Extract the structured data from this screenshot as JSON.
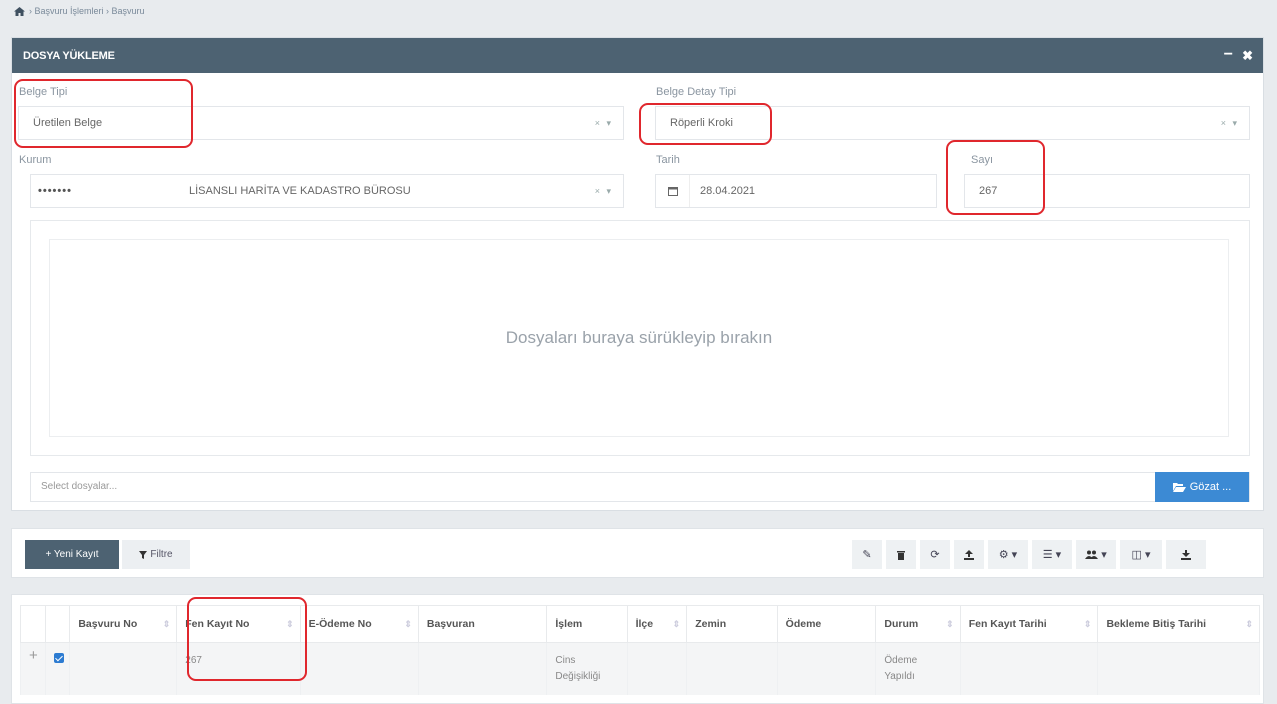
{
  "breadcrumb": {
    "icon": "home-icon",
    "text": "› Başvuru İşlemleri › Başvuru"
  },
  "panel": {
    "title": "DOSYA YÜKLEME",
    "minimize": "−",
    "close": "✖"
  },
  "form": {
    "belge_tipi": {
      "label": "Belge Tipi",
      "value": "Üretilen Belge",
      "controls": "× ▾"
    },
    "belge_detay_tipi": {
      "label": "Belge Detay Tipi",
      "value": "Röperli Kroki",
      "controls": "× ▾"
    },
    "kurum": {
      "label": "Kurum",
      "masked": "•••••••",
      "value": "LİSANSLI HARİTA VE KADASTRO BÜROSU",
      "controls": "× ▾"
    },
    "tarih": {
      "label": "Tarih",
      "value": "28.04.2021"
    },
    "sayi": {
      "label": "Sayı",
      "value": "267"
    }
  },
  "dropzone": {
    "text": "Dosyaları buraya sürükleyip bırakın"
  },
  "filebar": {
    "placeholder": "Select dosyalar...",
    "browse_label": "Gözat ..."
  },
  "toolbar": {
    "new_label": "+ Yeni Kayıt",
    "filter_label": "Filtre",
    "icons": [
      "pencil-icon",
      "trash-icon",
      "refresh-icon",
      "upload-icon",
      "settings-dropdown-icon",
      "list-dropdown-icon",
      "users-dropdown-icon",
      "columns-dropdown-icon",
      "download-icon"
    ]
  },
  "table": {
    "columns": [
      "Başvuru No",
      "Fen Kayıt No",
      "E-Ödeme No",
      "Başvuran",
      "İşlem",
      "İlçe",
      "Zemin",
      "Ödeme",
      "Durum",
      "Fen Kayıt Tarihi",
      "Bekleme Bitiş Tarihi"
    ],
    "rows": [
      {
        "expand": "+",
        "checked": true,
        "basvuru_no": "",
        "fen_kayit_no": "267",
        "e_odeme_no": "",
        "basvuran": "",
        "islem_1": "Cins",
        "islem_2": "Değişikliği",
        "ilce": "",
        "zemin": "",
        "odeme": "",
        "durum_1": "Ödeme",
        "durum_2": "Yapıldı",
        "fen_kayit_tarihi": "",
        "bekleme_bitis_tarihi": ""
      }
    ]
  },
  "highlight_color": "#e0272d",
  "header_color": "#4d6272",
  "browse_color": "#3c8ad4"
}
